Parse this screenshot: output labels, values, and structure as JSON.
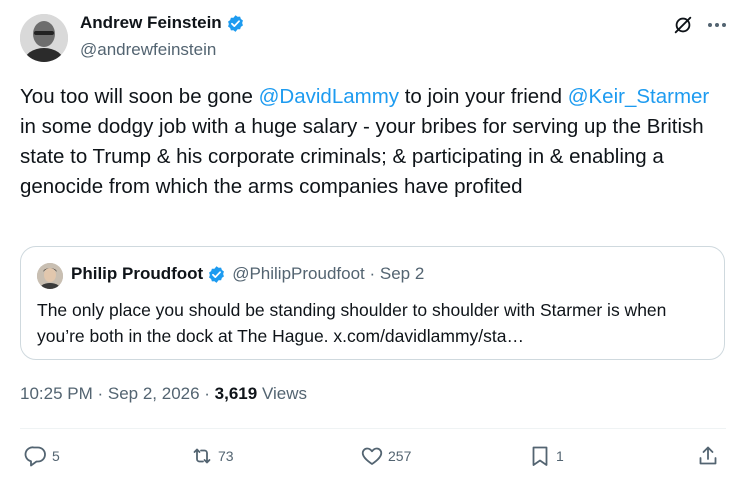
{
  "author": {
    "display_name": "Andrew Feinstein",
    "handle": "@andrewfeinstein"
  },
  "tweet": {
    "text_parts": [
      {
        "text": "You too will soon be gone ",
        "type": "text"
      },
      {
        "text": "@DavidLammy",
        "type": "mention"
      },
      {
        "text": " to join your friend ",
        "type": "text"
      },
      {
        "text": "@Keir_Starmer",
        "type": "mention"
      },
      {
        "text": " in some dodgy job with a huge salary - your bribes for serving up the British state to Trump & his corporate criminals; & participating in & enabling a genocide from which the arms companies have profited",
        "type": "text"
      }
    ]
  },
  "quote": {
    "display_name": "Philip Proudfoot",
    "meta": "@PhilipProudfoot · Sep 2",
    "text": "The only place you should be standing shoulder to shoulder with Starmer is when you’re both in the dock at The Hague. x.com/davidlammy/sta…"
  },
  "meta": {
    "timestamp": "10:25 PM · Sep 2, 2026 · ",
    "views_count": "3,619",
    "views_label": " Views"
  },
  "actions": {
    "replies": "5",
    "reposts": "73",
    "likes": "257",
    "bookmarks": "1"
  },
  "colors": {
    "accent": "#1d9bf0",
    "text": "#0f1419",
    "muted": "#536471",
    "border": "#cfd9de"
  },
  "icons": [
    "verified-badge-icon",
    "grok-icon",
    "more-icon",
    "reply-icon",
    "repost-icon",
    "like-icon",
    "bookmark-icon",
    "share-icon"
  ]
}
